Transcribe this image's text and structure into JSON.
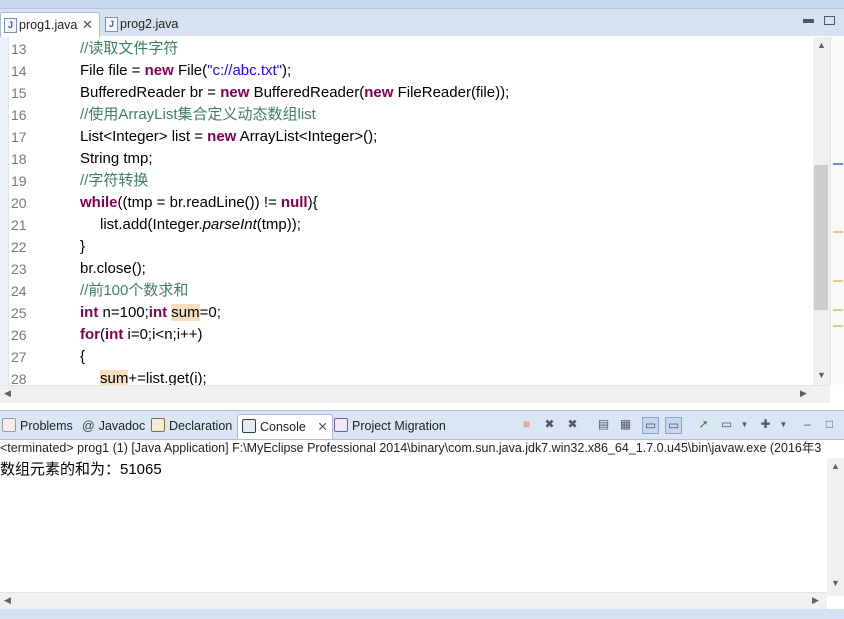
{
  "editor": {
    "tabs": [
      {
        "label": "prog1.java",
        "close": "✕",
        "active": true
      },
      {
        "label": "prog2.java",
        "active": false
      }
    ],
    "lines": [
      {
        "num": "13",
        "indent": 1,
        "tokens": [
          {
            "t": "//读取文件字符",
            "c": "cm"
          }
        ]
      },
      {
        "num": "14",
        "indent": 1,
        "tokens": [
          {
            "t": "File file = ",
            "c": ""
          },
          {
            "t": "new",
            "c": "kw"
          },
          {
            "t": " File(",
            "c": ""
          },
          {
            "t": "\"c://abc.txt\"",
            "c": "st"
          },
          {
            "t": ");",
            "c": ""
          }
        ]
      },
      {
        "num": "15",
        "indent": 1,
        "tokens": [
          {
            "t": "BufferedReader br = ",
            "c": ""
          },
          {
            "t": "new",
            "c": "kw"
          },
          {
            "t": " BufferedReader(",
            "c": ""
          },
          {
            "t": "new",
            "c": "kw"
          },
          {
            "t": " FileReader(file));",
            "c": ""
          }
        ]
      },
      {
        "num": "16",
        "indent": 1,
        "tokens": [
          {
            "t": "//使用ArrayList集合定义动态数组list",
            "c": "cm"
          }
        ]
      },
      {
        "num": "17",
        "indent": 1,
        "tokens": [
          {
            "t": "List<Integer> list = ",
            "c": ""
          },
          {
            "t": "new",
            "c": "kw"
          },
          {
            "t": " ArrayList<Integer>();",
            "c": ""
          }
        ]
      },
      {
        "num": "18",
        "indent": 1,
        "tokens": [
          {
            "t": "String tmp;",
            "c": ""
          }
        ]
      },
      {
        "num": "19",
        "indent": 1,
        "tokens": [
          {
            "t": "//字符转换",
            "c": "cm"
          }
        ]
      },
      {
        "num": "20",
        "indent": 1,
        "tokens": [
          {
            "t": "while",
            "c": "kw"
          },
          {
            "t": "((tmp = br.readLine()) != ",
            "c": ""
          },
          {
            "t": "null",
            "c": "kw"
          },
          {
            "t": "){",
            "c": ""
          }
        ]
      },
      {
        "num": "21",
        "indent": 2,
        "tokens": [
          {
            "t": "list.add(Integer.",
            "c": ""
          },
          {
            "t": "parseInt",
            "c": "it"
          },
          {
            "t": "(tmp));",
            "c": ""
          }
        ]
      },
      {
        "num": "22",
        "indent": 1,
        "tokens": [
          {
            "t": "}",
            "c": ""
          }
        ]
      },
      {
        "num": "23",
        "indent": 1,
        "tokens": [
          {
            "t": "br.close();",
            "c": ""
          }
        ]
      },
      {
        "num": "24",
        "indent": 1,
        "tokens": [
          {
            "t": "//前100个数求和",
            "c": "cm"
          }
        ]
      },
      {
        "num": "25",
        "indent": 1,
        "tokens": [
          {
            "t": "int",
            "c": "kw"
          },
          {
            "t": " n=100;",
            "c": ""
          },
          {
            "t": "int",
            "c": "kw"
          },
          {
            "t": " ",
            "c": ""
          },
          {
            "t": "sum",
            "c": "hl"
          },
          {
            "t": "=0;",
            "c": ""
          }
        ]
      },
      {
        "num": "26",
        "indent": 1,
        "tokens": [
          {
            "t": "for",
            "c": "kw"
          },
          {
            "t": "(",
            "c": ""
          },
          {
            "t": "int",
            "c": "kw"
          },
          {
            "t": " i=0;i<n;i++)",
            "c": ""
          }
        ]
      },
      {
        "num": "27",
        "indent": 1,
        "tokens": [
          {
            "t": "{",
            "c": ""
          }
        ]
      },
      {
        "num": "28",
        "indent": 2,
        "tokens": [
          {
            "t": "sum",
            "c": "hl"
          },
          {
            "t": "+=list.get(i);",
            "c": ""
          }
        ]
      }
    ]
  },
  "panel": {
    "tabs": [
      {
        "id": "problems",
        "label": "Problems",
        "icon": "problems-icon",
        "color": "#c0392b"
      },
      {
        "id": "javadoc",
        "label": "Javadoc",
        "icon": "at-icon",
        "color": ""
      },
      {
        "id": "declaration",
        "label": "Declaration",
        "icon": "declaration-icon",
        "color": "#8a6d3b"
      },
      {
        "id": "console",
        "label": "Console",
        "icon": "console-icon",
        "color": "#2c3e50",
        "close": "✕",
        "active": true
      },
      {
        "id": "migration",
        "label": "Project Migration",
        "icon": "migration-icon",
        "color": "#7a5a9a"
      }
    ],
    "javadoc_symbol": "@",
    "console_header": "<terminated> prog1 (1) [Java Application] F:\\MyEclipse Professional 2014\\binary\\com.sun.java.jdk7.win32.x86_64_1.7.0.u45\\bin\\javaw.exe (2016年3",
    "console_output": "数组元素的和为：51065"
  },
  "colors": {
    "keyword": "#7f0055",
    "comment": "#3f7f5f",
    "string": "#2a00ff",
    "highlight": "#f6dfbe"
  }
}
